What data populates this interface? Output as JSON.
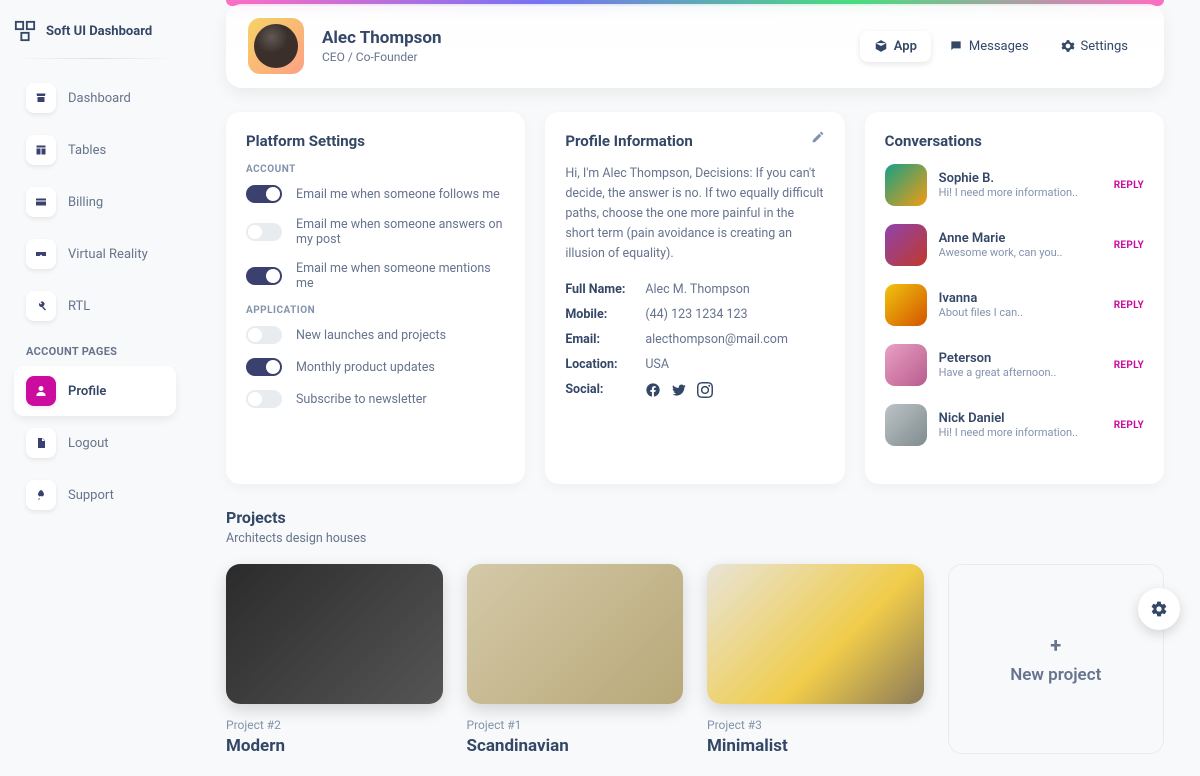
{
  "logo": "Soft UI Dashboard",
  "nav": [
    {
      "label": "Dashboard",
      "icon": "shop"
    },
    {
      "label": "Tables",
      "icon": "table"
    },
    {
      "label": "Billing",
      "icon": "card"
    },
    {
      "label": "Virtual Reality",
      "icon": "vr"
    },
    {
      "label": "RTL",
      "icon": "tools"
    }
  ],
  "nav_header": "ACCOUNT PAGES",
  "nav2": [
    {
      "label": "Profile",
      "icon": "user",
      "active": true
    },
    {
      "label": "Logout",
      "icon": "doc"
    },
    {
      "label": "Support",
      "icon": "rocket"
    }
  ],
  "header": {
    "name": "Alec Thompson",
    "role": "CEO / Co-Founder",
    "tabs": [
      {
        "label": "App",
        "active": true
      },
      {
        "label": "Messages"
      },
      {
        "label": "Settings"
      }
    ]
  },
  "settings": {
    "title": "Platform Settings",
    "s1": "ACCOUNT",
    "account": [
      {
        "label": "Email me when someone follows me",
        "on": true
      },
      {
        "label": "Email me when someone answers on my post",
        "on": false
      },
      {
        "label": "Email me when someone mentions me",
        "on": true
      }
    ],
    "s2": "APPLICATION",
    "application": [
      {
        "label": "New launches and projects",
        "on": false
      },
      {
        "label": "Monthly product updates",
        "on": true
      },
      {
        "label": "Subscribe to newsletter",
        "on": false
      }
    ]
  },
  "profile": {
    "title": "Profile Information",
    "bio": "Hi, I'm Alec Thompson, Decisions: If you can't decide, the answer is no. If two equally difficult paths, choose the one more painful in the short term (pain avoidance is creating an illusion of equality).",
    "rows": [
      {
        "k": "Full Name:",
        "v": "Alec M. Thompson"
      },
      {
        "k": "Mobile:",
        "v": "(44) 123 1234 123"
      },
      {
        "k": "Email:",
        "v": "alecthompson@mail.com"
      },
      {
        "k": "Location:",
        "v": "USA"
      }
    ],
    "social_label": "Social:"
  },
  "conversations": {
    "title": "Conversations",
    "reply": "REPLY",
    "list": [
      {
        "name": "Sophie B.",
        "msg": "Hi! I need more information..",
        "cls": "ca1"
      },
      {
        "name": "Anne Marie",
        "msg": "Awesome work, can you..",
        "cls": "ca2"
      },
      {
        "name": "Ivanna",
        "msg": "About files I can..",
        "cls": "ca3"
      },
      {
        "name": "Peterson",
        "msg": "Have a great afternoon..",
        "cls": "ca4"
      },
      {
        "name": "Nick Daniel",
        "msg": "Hi! I need more information..",
        "cls": "ca5"
      }
    ]
  },
  "projects": {
    "title": "Projects",
    "desc": "Architects design houses",
    "list": [
      {
        "tag": "Project #2",
        "name": "Modern",
        "cls": "pi1"
      },
      {
        "tag": "Project #1",
        "name": "Scandinavian",
        "cls": "pi2"
      },
      {
        "tag": "Project #3",
        "name": "Minimalist",
        "cls": "pi3"
      }
    ],
    "new_label": "New project"
  }
}
